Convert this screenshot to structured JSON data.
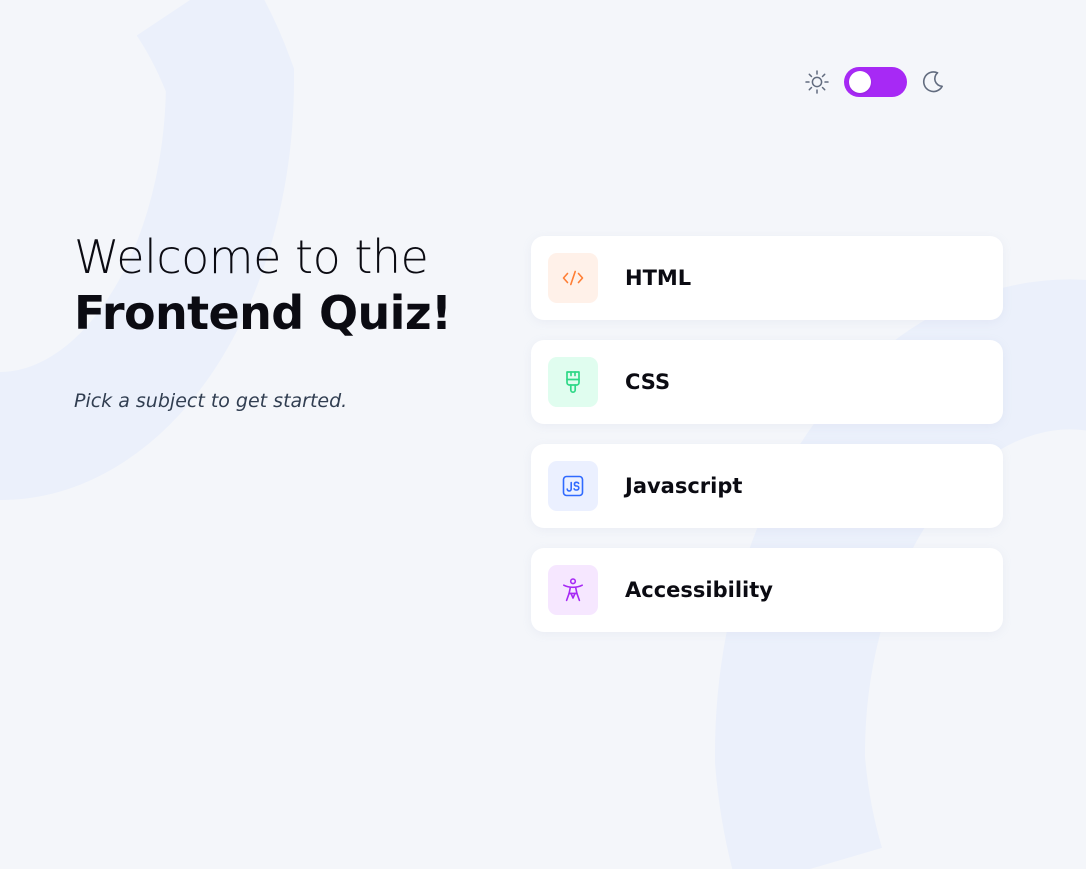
{
  "page": {
    "headline_line1": "Welcome to the",
    "headline_line2": "Frontend Quiz!",
    "subtitle": "Pick a subject to get started."
  },
  "theme_switcher": {
    "light_icon": "sun-icon",
    "dark_icon": "moon-icon",
    "accent_color": "#a729f5",
    "knob_position": "left"
  },
  "subjects": [
    {
      "label": "HTML",
      "icon": "html-code-icon",
      "icon_bg": "#fff1e9",
      "icon_color": "#ff7e35"
    },
    {
      "label": "CSS",
      "icon": "css-brush-icon",
      "icon_bg": "#e0fdef",
      "icon_color": "#2fd887"
    },
    {
      "label": "Javascript",
      "icon": "javascript-js-icon",
      "icon_bg": "#ebf0ff",
      "icon_color": "#306aff"
    },
    {
      "label": "Accessibility",
      "icon": "accessibility-person-icon",
      "icon_bg": "#f6e7ff",
      "icon_color": "#a729f5"
    }
  ],
  "colors": {
    "background": "#f4f6fa",
    "card": "#ffffff",
    "text_primary": "#0b0b12",
    "text_secondary": "#313e51",
    "decor": "#ebf0fb"
  }
}
